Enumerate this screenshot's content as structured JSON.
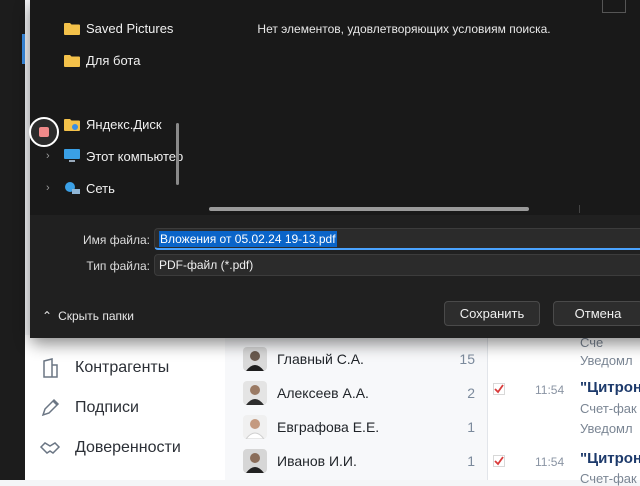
{
  "dialog": {
    "empty_message": "Нет элементов, удовлетворяющих условиям поиска.",
    "tree": [
      {
        "label": "Saved Pictures",
        "icon": "folder-icon"
      },
      {
        "label": "Для бота",
        "icon": "folder-icon"
      },
      {
        "label": "Яндекс.Диск",
        "icon": "yandex-disk-folder-icon"
      },
      {
        "label": "Этот компьютер",
        "icon": "computer-icon"
      },
      {
        "label": "Сеть",
        "icon": "network-icon"
      }
    ],
    "filename_label": "Имя файла:",
    "filename_value": "Вложения от 05.02.24 19-13.pdf",
    "filetype_label": "Тип файла:",
    "filetype_value": "PDF-файл (*.pdf)",
    "hide_folders": "Скрыть папки",
    "save_button": "Сохранить",
    "cancel_button": "Отмена",
    "colors": {
      "accent": "#0a64c8",
      "background": "#202020"
    }
  },
  "app": {
    "nav": [
      {
        "label": "Контрагенты",
        "icon": "building-icon"
      },
      {
        "label": "Подписи",
        "icon": "pen-icon"
      },
      {
        "label": "Доверенности",
        "icon": "handshake-icon"
      }
    ],
    "contacts": [
      {
        "name": "Главный С.А.",
        "count": "15"
      },
      {
        "name": "Алексеев А.А.",
        "count": "2"
      },
      {
        "name": "Евграфова Е.Е.",
        "count": "1"
      },
      {
        "name": "Иванов И.И.",
        "count": "1"
      }
    ],
    "messages": {
      "top_sub": "Сче",
      "top_sub2": "Уведомл",
      "items": [
        {
          "time": "11:54",
          "title": "\"Цитрон",
          "sub": "Счет-фак",
          "sub2": "Уведомл"
        },
        {
          "time": "11:54",
          "title": "\"Цитрон",
          "sub": "Счет-фак"
        }
      ]
    }
  }
}
